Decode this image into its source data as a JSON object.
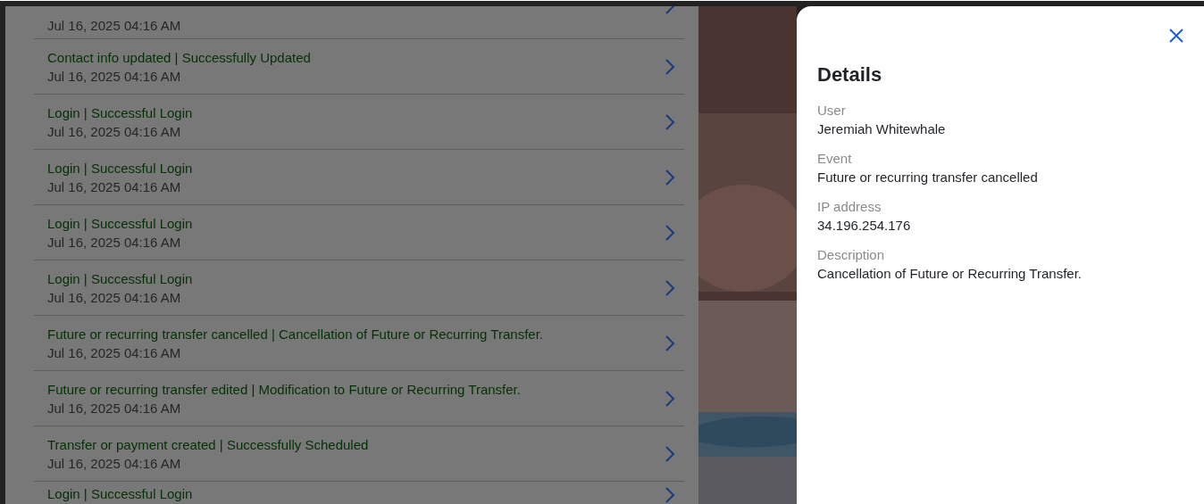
{
  "activity_list": [
    {
      "date": "Jul 16, 2025 04:16 AM"
    },
    {
      "title": "Contact info updated | Successfully Updated",
      "date": "Jul 16, 2025 04:16 AM"
    },
    {
      "title": "Login | Successful Login",
      "date": "Jul 16, 2025 04:16 AM"
    },
    {
      "title": "Login | Successful Login",
      "date": "Jul 16, 2025 04:16 AM"
    },
    {
      "title": "Login | Successful Login",
      "date": "Jul 16, 2025 04:16 AM"
    },
    {
      "title": "Login | Successful Login",
      "date": "Jul 16, 2025 04:16 AM"
    },
    {
      "title": "Future or recurring transfer cancelled | Cancellation of Future or Recurring Transfer.",
      "date": "Jul 16, 2025 04:16 AM"
    },
    {
      "title": "Future or recurring transfer edited | Modification to Future or Recurring Transfer.",
      "date": "Jul 16, 2025 04:16 AM"
    },
    {
      "title": "Transfer or payment created | Successfully Scheduled",
      "date": "Jul 16, 2025 04:16 AM"
    },
    {
      "title": "Login | Successful Login"
    }
  ],
  "details": {
    "title": "Details",
    "fields": [
      {
        "label": "User",
        "value": "Jeremiah Whitewhale"
      },
      {
        "label": "Event",
        "value": "Future or recurring transfer cancelled"
      },
      {
        "label": "IP address",
        "value": "34.196.254.176"
      },
      {
        "label": "Description",
        "value": "Cancellation of Future or Recurring Transfer."
      }
    ]
  }
}
